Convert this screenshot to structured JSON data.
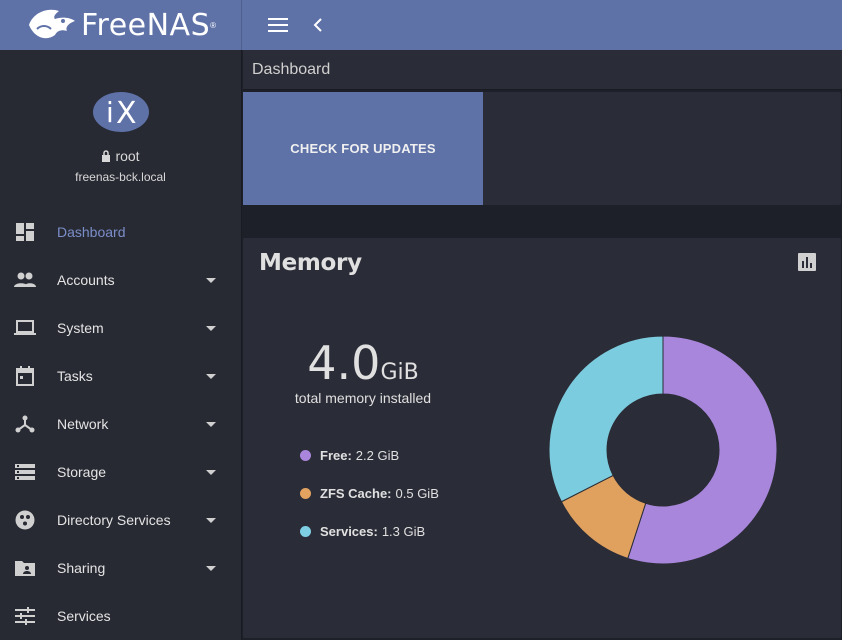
{
  "header": {
    "brand": "FreeNAS",
    "brand_tm": "®"
  },
  "sidebar": {
    "user": "root",
    "hostname": "freenas-bck.local",
    "items": [
      {
        "label": "Dashboard",
        "icon": "dashboard-icon",
        "active": true,
        "expandable": false
      },
      {
        "label": "Accounts",
        "icon": "people-icon",
        "active": false,
        "expandable": true
      },
      {
        "label": "System",
        "icon": "laptop-icon",
        "active": false,
        "expandable": true
      },
      {
        "label": "Tasks",
        "icon": "calendar-icon",
        "active": false,
        "expandable": true
      },
      {
        "label": "Network",
        "icon": "network-icon",
        "active": false,
        "expandable": true
      },
      {
        "label": "Storage",
        "icon": "storage-icon",
        "active": false,
        "expandable": true
      },
      {
        "label": "Directory Services",
        "icon": "directory-icon",
        "active": false,
        "expandable": true
      },
      {
        "label": "Sharing",
        "icon": "folder-shared-icon",
        "active": false,
        "expandable": true
      },
      {
        "label": "Services",
        "icon": "tune-icon",
        "active": false,
        "expandable": false
      }
    ]
  },
  "breadcrumb": "Dashboard",
  "update_card": {
    "button_label": "CHECK FOR UPDATES"
  },
  "memory": {
    "title": "Memory",
    "total_value": "4.0",
    "total_unit": "GiB",
    "total_caption": "total memory installed",
    "legend": [
      {
        "name": "Free:",
        "value": "2.2 GiB",
        "color": "#a986dc"
      },
      {
        "name": "ZFS Cache:",
        "value": "0.5 GiB",
        "color": "#e3a25f"
      },
      {
        "name": "Services:",
        "value": "1.3 GiB",
        "color": "#7ecfe3"
      }
    ]
  },
  "colors": {
    "accent": "#5f72a8",
    "active_nav": "#7b8ec8",
    "card_bg": "#2a2c37"
  },
  "chart_data": {
    "type": "pie",
    "categories": [
      "Free",
      "ZFS Cache",
      "Services"
    ],
    "values": [
      2.2,
      0.5,
      1.3
    ],
    "colors": [
      "#a886db",
      "#e0a15f",
      "#7cccdf"
    ],
    "unit": "GiB"
  }
}
